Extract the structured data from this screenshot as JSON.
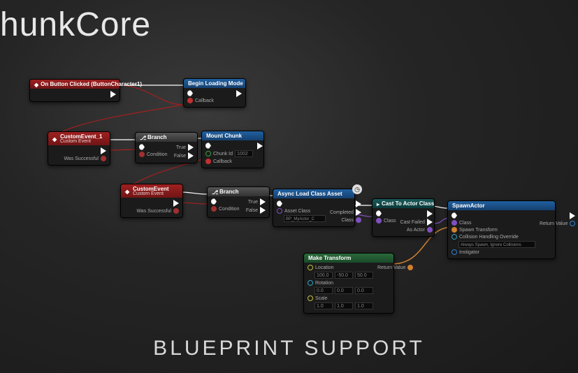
{
  "title": "hunkCore",
  "subtitle": "BLUEPRINT SUPPORT",
  "nodes": {
    "onButton": {
      "label": "On Button Clicked (ButtonCharacter1)"
    },
    "beginLoading": {
      "label": "Begin Loading Mode",
      "callback": "Callback"
    },
    "customEvent1": {
      "label": "CustomEvent_1",
      "sub": "Custom Event",
      "wasSuccessful": "Was Successful"
    },
    "branch1": {
      "label": "Branch",
      "condition": "Condition",
      "trueLabel": "True",
      "falseLabel": "False"
    },
    "mountChunk": {
      "label": "Mount Chunk",
      "chunkId": "Chunk Id",
      "chunkIdValue": "1002",
      "callback": "Callback"
    },
    "customEvent2": {
      "label": "CustomEvent",
      "sub": "Custom Event",
      "wasSuccessful": "Was Successful"
    },
    "branch2": {
      "label": "Branch",
      "condition": "Condition",
      "trueLabel": "True",
      "falseLabel": "False"
    },
    "asyncLoad": {
      "label": "Async Load Class Asset",
      "assetClass": "Asset Class",
      "assetClassValue": "BP_MyActor_C",
      "completed": "Completed",
      "class": "Class"
    },
    "castToActor": {
      "label": "Cast To Actor Class",
      "class": "Class",
      "castFailed": "Cast Failed",
      "asActor": "As Actor"
    },
    "spawnActor": {
      "label": "SpawnActor",
      "class": "Class",
      "spawnTransform": "Spawn Transform",
      "collision": "Collision Handling Override",
      "collisionValue": "Always Spawn, Ignore Collisions",
      "instigator": "Instigator",
      "returnValue": "Return Value"
    },
    "makeTransform": {
      "label": "Make Transform",
      "location": "Location",
      "locX": "100.0",
      "locY": "-50.0",
      "locZ": "50.0",
      "rotation": "Rotation",
      "rotX": "0.0",
      "rotY": "0.0",
      "rotZ": "0.0",
      "scale": "Scale",
      "scaleX": "1.0",
      "scaleY": "1.0",
      "scaleZ": "1.0",
      "returnValue": "Return Value"
    }
  }
}
